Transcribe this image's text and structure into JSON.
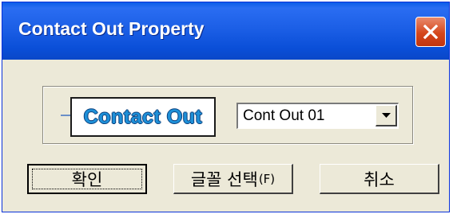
{
  "window": {
    "title": "Contact Out Property"
  },
  "preview": {
    "label": "Contact Out"
  },
  "combo": {
    "value": "Cont Out 01"
  },
  "buttons": {
    "ok": "확인",
    "font_select": "글꼴 선택",
    "font_select_mnemonic": "(F)",
    "cancel": "취소"
  },
  "icons": {
    "close": "close-icon",
    "dropdown": "chevron-down-icon"
  },
  "colors": {
    "titlebar": "#0a5ee8",
    "close_button": "#d5471c",
    "dialog_face": "#ece9d8",
    "contact_text": "#1e90d8"
  }
}
